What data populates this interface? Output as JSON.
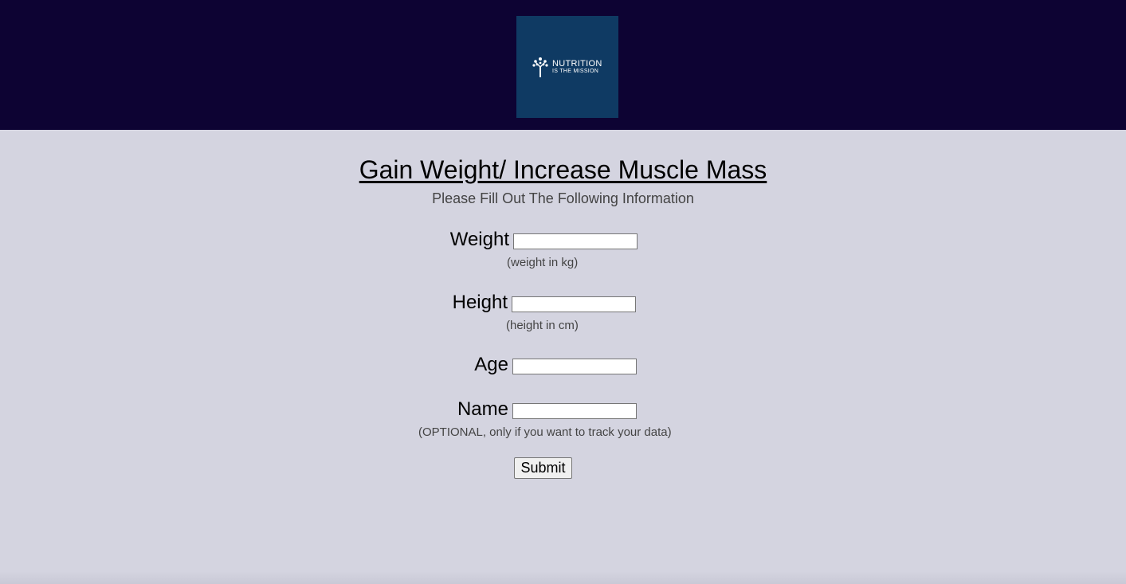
{
  "logo": {
    "line1": "NUTRITION",
    "line2": "IS THE MISSION",
    "icon": "tree-icon"
  },
  "page": {
    "title": "Gain Weight/ Increase Muscle Mass",
    "subtitle": "Please Fill Out The Following Information"
  },
  "form": {
    "weight": {
      "label": "Weight",
      "value": "",
      "hint": "(weight in kg)"
    },
    "height": {
      "label": "Height",
      "value": "",
      "hint": "(height in cm)"
    },
    "age": {
      "label": "Age",
      "value": ""
    },
    "name": {
      "label": "Name",
      "value": "",
      "hint": "(OPTIONAL, only if you want to track your data)"
    },
    "submit_label": "Submit"
  },
  "colors": {
    "header_bg": "#0d0333",
    "logo_bg": "#0f3a63",
    "page_bg": "#d4d4e0"
  }
}
